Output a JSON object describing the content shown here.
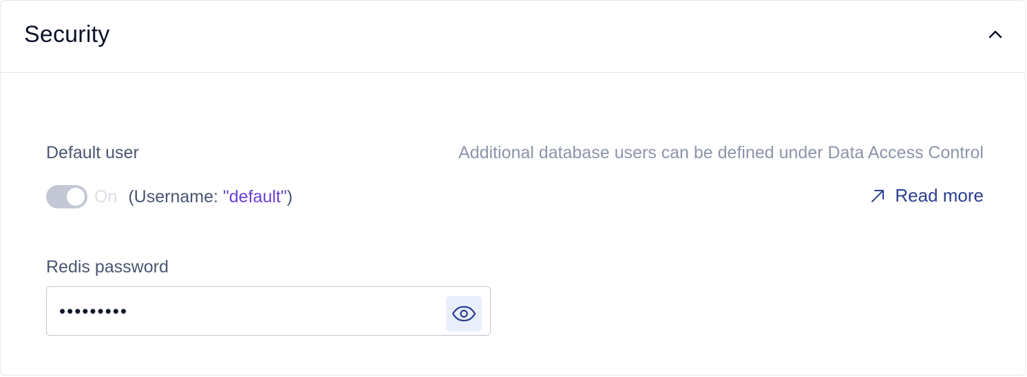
{
  "section": {
    "title": "Security",
    "collapse_icon": "chevron-up-icon"
  },
  "default_user": {
    "label": "Default user",
    "hint": "Additional database users can be defined under Data Access Control",
    "toggle_state": "On",
    "toggle_enabled": true,
    "toggle_disabled": true,
    "username_prefix": "(Username: ",
    "username_value": "\"default\"",
    "username_suffix": ")",
    "read_more_label": "Read more",
    "read_more_icon": "external-link-arrow-icon"
  },
  "password": {
    "label": "Redis password",
    "value": "•••••••••",
    "toggle_visibility_icon": "eye-icon"
  },
  "colors": {
    "title": "#0b1127",
    "label": "#4a5572",
    "hint": "#8c94a8",
    "link": "#2b3d8f",
    "username_value": "#6a3fdc",
    "toggle_track": "#c3c8d4",
    "eye_button_bg": "#e9eefb"
  }
}
